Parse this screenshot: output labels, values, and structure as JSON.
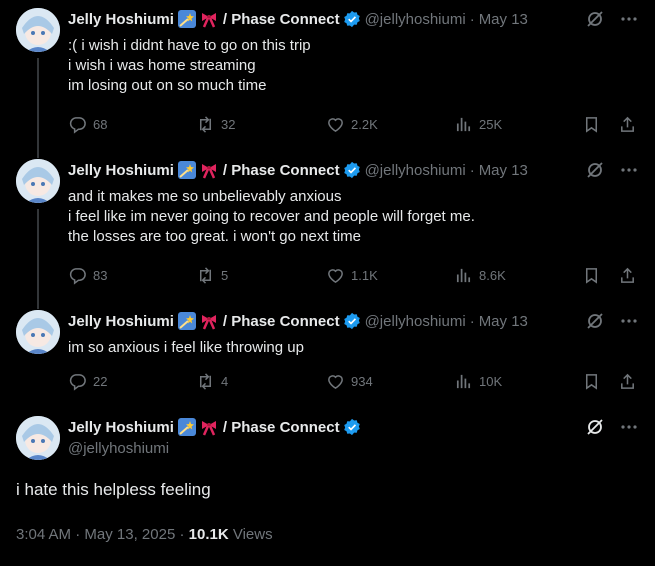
{
  "colors": {
    "bg": "#000000",
    "text": "#e7e9ea",
    "muted": "#71767b",
    "verified": "#1d9bf0",
    "line": "#333639"
  },
  "author": {
    "name": "Jelly Hoshiumi",
    "org": "/ Phase Connect",
    "handle": "@jellyhoshiumi",
    "badges": [
      "shooting-star-emoji",
      "ribbon-emoji"
    ]
  },
  "tweets": [
    {
      "date": "May 13",
      "lines": [
        ":( i wish i didnt have to go on this trip",
        "i wish i was home streaming",
        "im losing out on so much time"
      ],
      "replies": "68",
      "reposts": "32",
      "likes": "2.2K",
      "views": "25K"
    },
    {
      "date": "May 13",
      "lines": [
        "and it makes me so unbelievably anxious",
        "i feel like im never going to recover and people will forget me.",
        "the losses are too great. i won't go next time"
      ],
      "replies": "83",
      "reposts": "5",
      "likes": "1.1K",
      "views": "8.6K"
    },
    {
      "date": "May 13",
      "lines": [
        "im so anxious i feel like throwing up"
      ],
      "replies": "22",
      "reposts": "4",
      "likes": "934",
      "views": "10K"
    }
  ],
  "main_tweet": {
    "text": "i hate this helpless feeling",
    "time": "3:04 AM",
    "date": "May 13, 2025",
    "views_count": "10.1K",
    "views_label": "Views"
  },
  "separators": {
    "dot": "·"
  }
}
